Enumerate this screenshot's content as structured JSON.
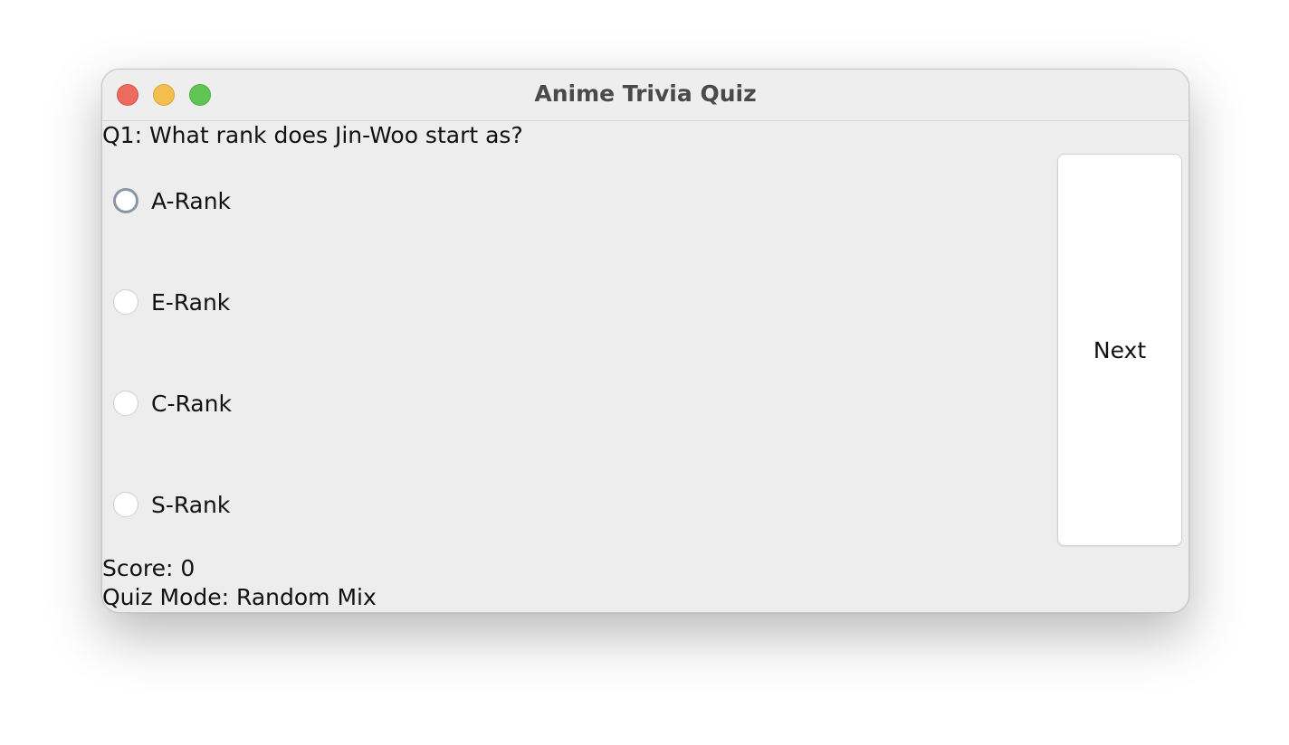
{
  "window": {
    "title": "Anime Trivia Quiz"
  },
  "quiz": {
    "question": "Q1: What rank does Jin-Woo start as?",
    "options": [
      {
        "label": "A-Rank",
        "selected": false
      },
      {
        "label": "E-Rank",
        "selected": false
      },
      {
        "label": "C-Rank",
        "selected": false
      },
      {
        "label": "S-Rank",
        "selected": false
      }
    ],
    "next_label": "Next"
  },
  "status": {
    "score": "Score: 0",
    "mode": "Quiz Mode: Random Mix"
  },
  "colors": {
    "close": "#ec6a5e",
    "minimize": "#f4bf4f",
    "zoom": "#61c554"
  }
}
